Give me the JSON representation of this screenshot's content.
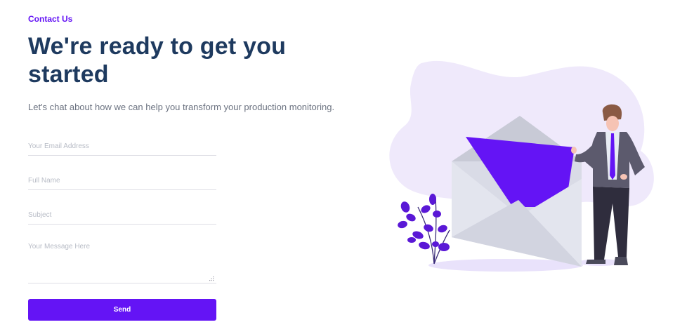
{
  "header": {
    "eyebrow": "Contact Us",
    "title": "We're ready to get you started",
    "subtitle": "Let's chat about how we can help you transform your production monitoring."
  },
  "form": {
    "email_placeholder": "Your Email Address",
    "name_placeholder": "Full Name",
    "subject_placeholder": "Subject",
    "message_placeholder": "Your Message Here",
    "send_label": "Send"
  },
  "colors": {
    "accent": "#6414f5",
    "heading": "#1e3a5f",
    "blob": "#efe9fb"
  },
  "icons": [
    "resize-grip-icon",
    "contact-illustration"
  ]
}
